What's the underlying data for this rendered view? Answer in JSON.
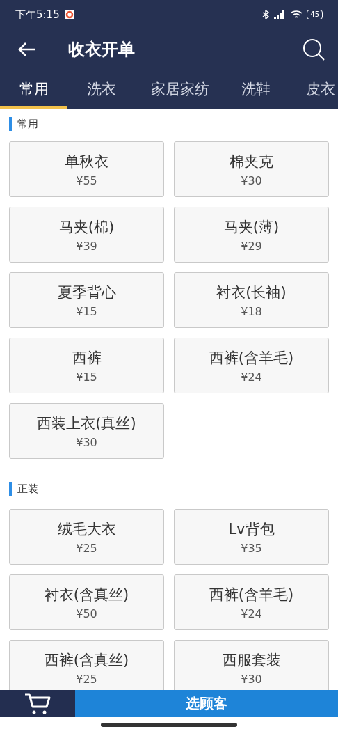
{
  "status_bar": {
    "time": "下午5:15",
    "battery": "45"
  },
  "app_bar": {
    "title": "收衣开单"
  },
  "tabs": [
    {
      "label": "常用",
      "selected": true
    },
    {
      "label": "洗衣",
      "selected": false
    },
    {
      "label": "家居家纺",
      "selected": false
    },
    {
      "label": "洗鞋",
      "selected": false
    },
    {
      "label": "皮衣",
      "selected": false
    }
  ],
  "sections": [
    {
      "title": "常用",
      "items": [
        {
          "name": "单秋衣",
          "price": "¥55"
        },
        {
          "name": "棉夹克",
          "price": "¥30"
        },
        {
          "name": "马夹(棉)",
          "price": "¥39"
        },
        {
          "name": "马夹(薄)",
          "price": "¥29"
        },
        {
          "name": "夏季背心",
          "price": "¥15"
        },
        {
          "name": "衬衣(长袖)",
          "price": "¥18"
        },
        {
          "name": "西裤",
          "price": "¥15"
        },
        {
          "name": "西裤(含羊毛)",
          "price": "¥24"
        },
        {
          "name": "西装上衣(真丝)",
          "price": "¥30"
        }
      ]
    },
    {
      "title": "正装",
      "items": [
        {
          "name": "绒毛大衣",
          "price": "¥25"
        },
        {
          "name": "Lv背包",
          "price": "¥35"
        },
        {
          "name": "衬衣(含真丝)",
          "price": "¥50"
        },
        {
          "name": "西裤(含羊毛)",
          "price": "¥24"
        },
        {
          "name": "西裤(含真丝)",
          "price": "¥25"
        },
        {
          "name": "西服套装",
          "price": "¥30"
        }
      ]
    }
  ],
  "bottom_bar": {
    "action": "选顾客"
  }
}
